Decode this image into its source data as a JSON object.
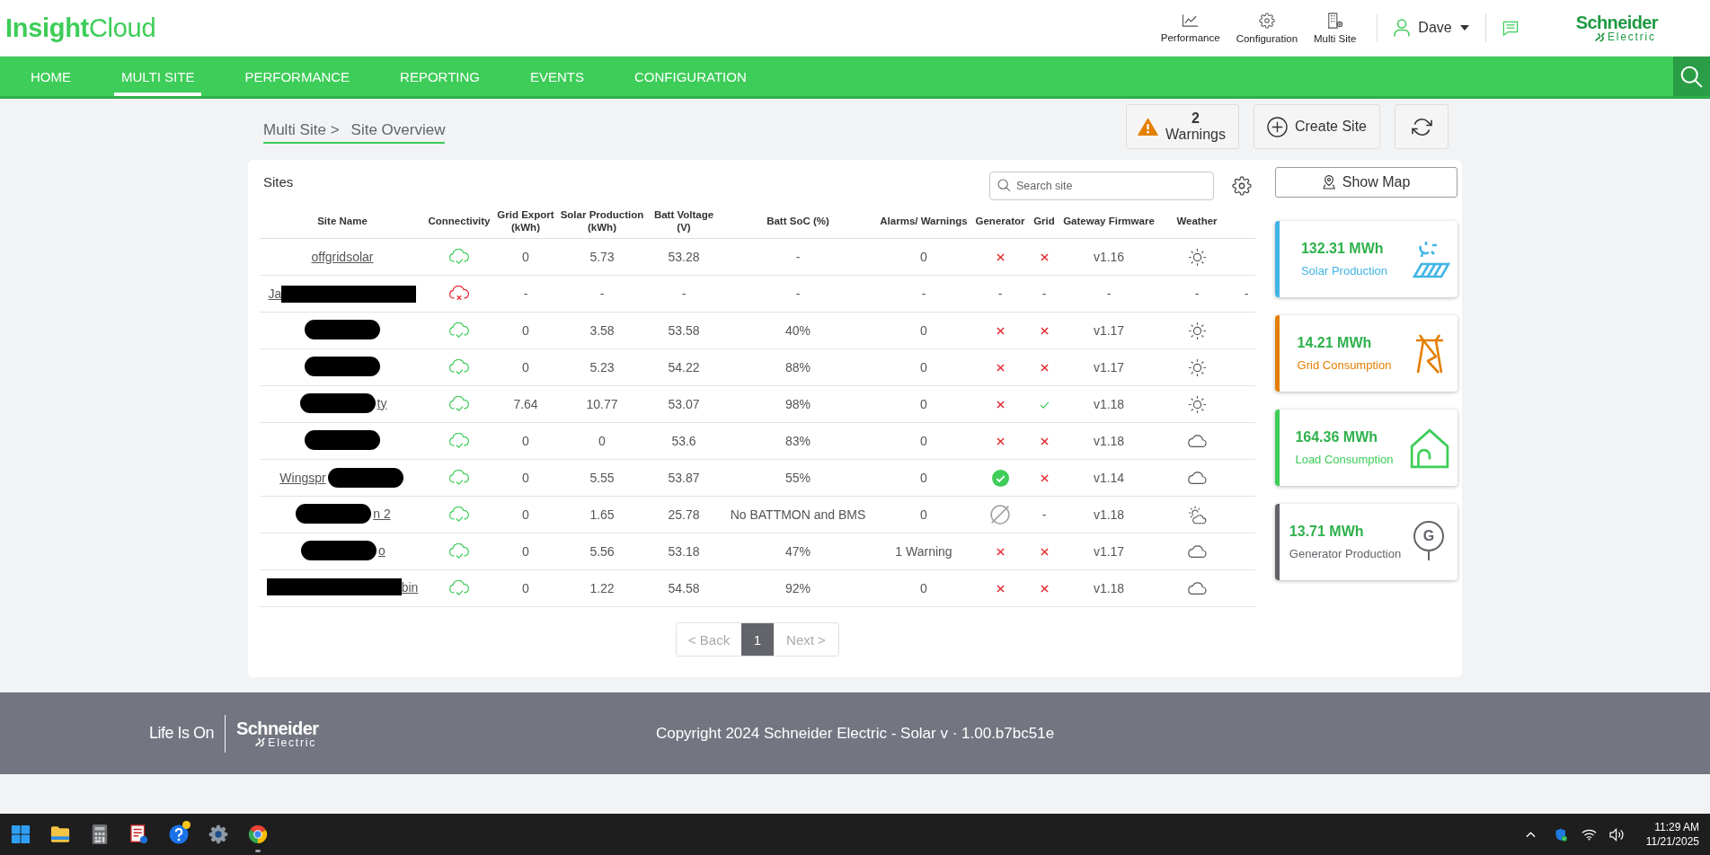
{
  "header": {
    "logo": "**Insight**Cloud",
    "shortcuts": [
      {
        "kind": "performance",
        "label": "Performance"
      },
      {
        "kind": "configuration",
        "label": "Configuration"
      },
      {
        "kind": "multi-site",
        "label": "Multi Site"
      }
    ],
    "user": "Dave",
    "brand": {
      "name": "Schneider",
      "sub": "Electric"
    }
  },
  "nav": {
    "items": [
      {
        "label": "HOME",
        "selected": false
      },
      {
        "label": "MULTI SITE",
        "selected": true
      },
      {
        "label": "PERFORMANCE",
        "selected": false
      },
      {
        "label": "REPORTING",
        "selected": false
      },
      {
        "label": "EVENTS",
        "selected": false
      },
      {
        "label": "CONFIGURATION",
        "selected": false
      }
    ]
  },
  "breadcrumb": [
    "Multi Site >",
    "Site Overview"
  ],
  "actions": {
    "warnings": {
      "count": "2",
      "label": "Warnings"
    },
    "create_site": "Create Site"
  },
  "sites": {
    "title": "Sites",
    "search": {
      "placeholder": "Search site"
    },
    "columns": [
      "Site Name",
      "Connectivity",
      "Grid Export (kWh)",
      "Solar Production (kWh)",
      "Batt Voltage (V)",
      "Batt SoC (%)",
      "Alarms/ Warnings",
      "Generator",
      "Grid",
      "Gateway Firmware",
      "Weather"
    ],
    "rows": [
      {
        "kind": "plain",
        "name_start": "offgridsolar",
        "connected": true,
        "grid_export": "0",
        "solar_production": "5.73",
        "batt_voltage": "53.28",
        "batt_soc": "-",
        "alarms": "0",
        "generator": {
          "kind": "cross"
        },
        "grid": {
          "kind": "cross"
        },
        "firmware": "v1.16",
        "weather": {
          "kind": "sunny"
        }
      },
      {
        "kind": "bar",
        "name_start": "Ja",
        "connected": false,
        "grid_export": "-",
        "solar_production": "-",
        "batt_voltage": "-",
        "batt_soc": "-",
        "alarms": "-",
        "generator": {
          "kind": "text",
          "text": "-"
        },
        "grid": {
          "kind": "text",
          "text": "-"
        },
        "firmware": "-",
        "weather": {
          "kind": "text",
          "text": "-"
        },
        "trailing": "-"
      },
      {
        "kind": "blob",
        "connected": true,
        "grid_export": "0",
        "solar_production": "3.58",
        "batt_voltage": "53.58",
        "batt_soc": "40%",
        "alarms": "0",
        "generator": {
          "kind": "cross"
        },
        "grid": {
          "kind": "cross"
        },
        "firmware": "v1.17",
        "weather": {
          "kind": "sunny"
        }
      },
      {
        "kind": "blob",
        "connected": true,
        "grid_export": "0",
        "solar_production": "5.23",
        "batt_voltage": "54.22",
        "batt_soc": "88%",
        "alarms": "0",
        "generator": {
          "kind": "cross"
        },
        "grid": {
          "kind": "cross"
        },
        "firmware": "v1.17",
        "weather": {
          "kind": "sunny"
        }
      },
      {
        "kind": "blob",
        "name_end": "ty",
        "connected": true,
        "grid_export": "7.64",
        "solar_production": "10.77",
        "batt_voltage": "53.07",
        "batt_soc": "98%",
        "alarms": "0",
        "generator": {
          "kind": "cross"
        },
        "grid": {
          "kind": "check"
        },
        "firmware": "v1.18",
        "weather": {
          "kind": "sunny"
        }
      },
      {
        "kind": "blob",
        "connected": true,
        "grid_export": "0",
        "solar_production": "0",
        "batt_voltage": "53.6",
        "batt_soc": "83%",
        "alarms": "0",
        "generator": {
          "kind": "cross"
        },
        "grid": {
          "kind": "cross"
        },
        "firmware": "v1.18",
        "weather": {
          "kind": "cloudy"
        }
      },
      {
        "kind": "blob",
        "name_start": "Wingspr",
        "connected": true,
        "grid_export": "0",
        "solar_production": "5.55",
        "batt_voltage": "53.87",
        "batt_soc": "55%",
        "alarms": "0",
        "generator": {
          "kind": "check-circle"
        },
        "grid": {
          "kind": "cross"
        },
        "firmware": "v1.14",
        "weather": {
          "kind": "cloudy"
        }
      },
      {
        "kind": "blob",
        "name_end": "n 2",
        "connected": true,
        "grid_export": "0",
        "solar_production": "1.65",
        "batt_voltage": "25.78",
        "batt_soc": "No BATTMON and BMS",
        "alarms": "0",
        "generator": {
          "kind": "empty"
        },
        "grid": {
          "kind": "text",
          "text": "-"
        },
        "firmware": "v1.18",
        "weather": {
          "kind": "partly-cloudy"
        }
      },
      {
        "kind": "blob",
        "name_end": "o",
        "connected": true,
        "grid_export": "0",
        "solar_production": "5.56",
        "batt_voltage": "53.18",
        "batt_soc": "47%",
        "alarms": "1 Warning",
        "generator": {
          "kind": "cross"
        },
        "grid": {
          "kind": "cross"
        },
        "firmware": "v1.17",
        "weather": {
          "kind": "cloudy"
        }
      },
      {
        "kind": "bar",
        "name_end": "bin",
        "connected": true,
        "grid_export": "0",
        "solar_production": "1.22",
        "batt_voltage": "54.58",
        "batt_soc": "92%",
        "alarms": "0",
        "generator": {
          "kind": "cross"
        },
        "grid": {
          "kind": "cross"
        },
        "firmware": "v1.18",
        "weather": {
          "kind": "cloudy"
        }
      }
    ],
    "pagination": {
      "back": {
        "label": "< Back",
        "disabled": true
      },
      "pages": [
        {
          "label": "1",
          "selected": true
        }
      ],
      "next": {
        "label": "Next >",
        "disabled": true
      }
    }
  },
  "map_button": "Show Map",
  "summary_cards": [
    {
      "kind": "solar",
      "value": "132.31 MWh",
      "label": "Solar Production",
      "color": "#42b4e6"
    },
    {
      "kind": "grid",
      "value": "14.21 MWh",
      "label": "Grid Consumption",
      "color": "#e47f00"
    },
    {
      "kind": "load",
      "value": "164.36 MWh",
      "label": "Load Consumption",
      "color": "#3dcd58"
    },
    {
      "kind": "generator",
      "value": "13.71 MWh",
      "label": "Generator Production",
      "color": "#626469",
      "icon_text": "G"
    }
  ],
  "footer": {
    "tagline": "Life Is On",
    "brand": {
      "name": "Schneider",
      "sub": "Electric"
    },
    "copyright": "Copyright 2024 Schneider Electric - Solar v · 1.00.b7bc51e"
  },
  "taskbar": {
    "apps": [
      {
        "kind": "start",
        "notification": false,
        "running": false
      },
      {
        "kind": "files",
        "notification": false,
        "running": false
      },
      {
        "kind": "calculator",
        "notification": false,
        "running": false
      },
      {
        "kind": "document",
        "notification": false,
        "running": false
      },
      {
        "kind": "help",
        "notification": true,
        "running": false
      },
      {
        "kind": "settings",
        "notification": false,
        "running": false
      },
      {
        "kind": "browser",
        "notification": false,
        "running": true
      }
    ],
    "tray": [
      {
        "kind": "chevron"
      },
      {
        "kind": "shield"
      },
      {
        "kind": "wifi"
      },
      {
        "kind": "volume"
      }
    ],
    "time": "11:29 AM",
    "date": "11/21/2025"
  }
}
